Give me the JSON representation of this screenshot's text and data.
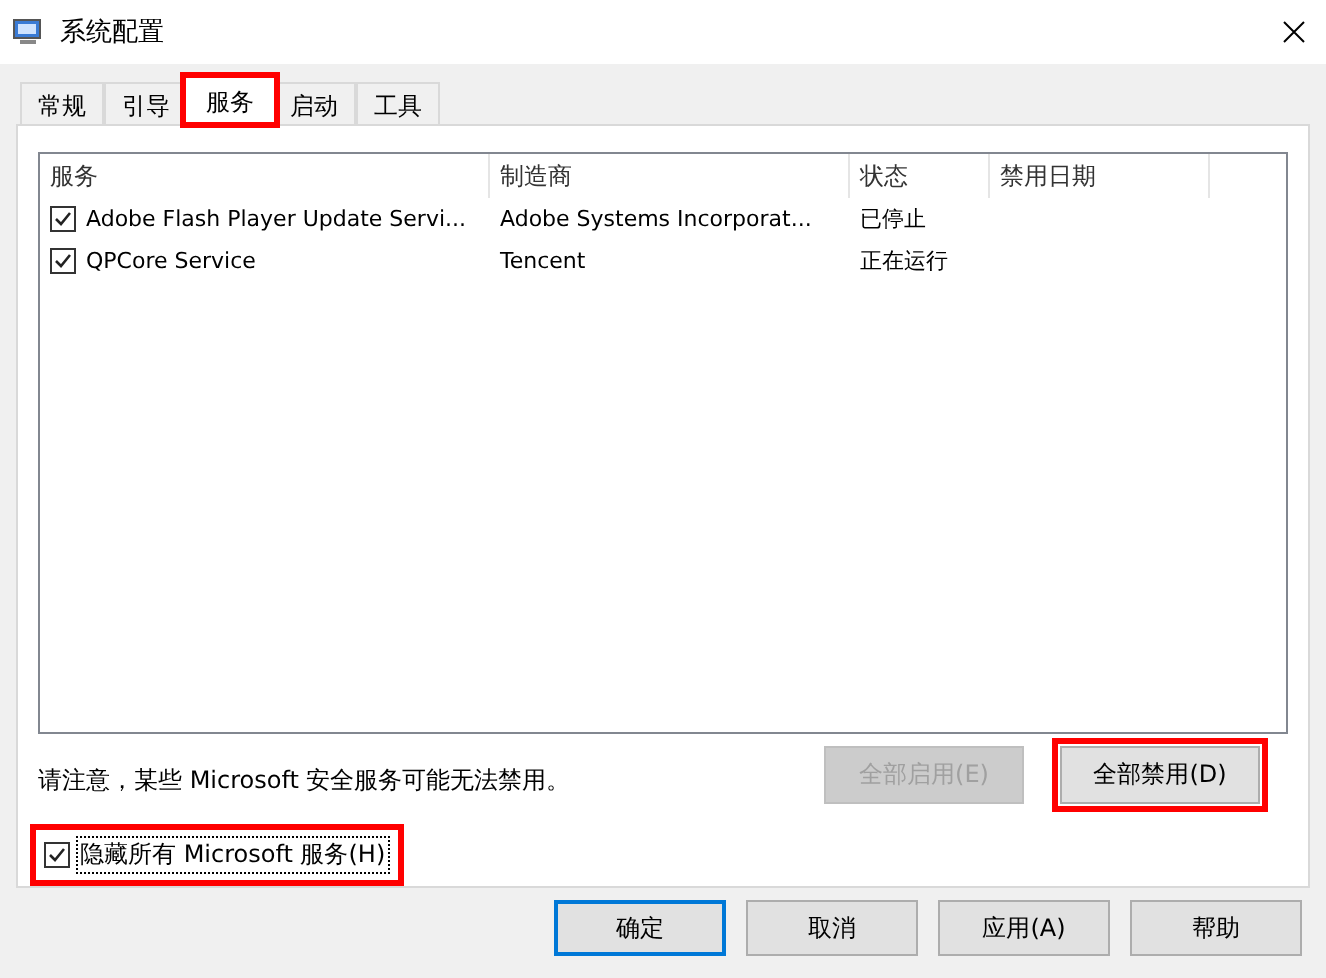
{
  "window": {
    "title": "系统配置"
  },
  "tabs": [
    {
      "label": "常规",
      "selected": false,
      "highlighted": false
    },
    {
      "label": "引导",
      "selected": false,
      "highlighted": false
    },
    {
      "label": "服务",
      "selected": true,
      "highlighted": true
    },
    {
      "label": "启动",
      "selected": false,
      "highlighted": false
    },
    {
      "label": "工具",
      "selected": false,
      "highlighted": false
    }
  ],
  "table": {
    "columns": [
      "服务",
      "制造商",
      "状态",
      "禁用日期"
    ],
    "rows": [
      {
        "checked": true,
        "cells": [
          "Adobe Flash Player Update Servi...",
          "Adobe Systems Incorporat...",
          "已停止",
          ""
        ]
      },
      {
        "checked": true,
        "cells": [
          "QPCore Service",
          "Tencent",
          "正在运行",
          ""
        ]
      }
    ]
  },
  "note": "请注意，某些 Microsoft 安全服务可能无法禁用。",
  "list_buttons": [
    {
      "label": "全部启用(E)",
      "disabled": true,
      "highlighted": false
    },
    {
      "label": "全部禁用(D)",
      "disabled": false,
      "highlighted": true
    }
  ],
  "hide_microsoft": {
    "label": "隐藏所有 Microsoft 服务(H)",
    "checked": true,
    "highlighted": true
  },
  "dialog_buttons": [
    {
      "label": "确定",
      "default": true
    },
    {
      "label": "取消",
      "default": false
    },
    {
      "label": "应用(A)",
      "default": false
    },
    {
      "label": "帮助",
      "default": false
    }
  ]
}
